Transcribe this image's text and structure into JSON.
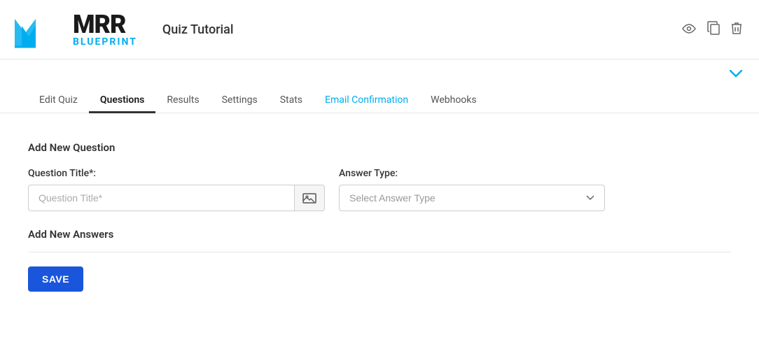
{
  "header": {
    "title": "Quiz Tutorial",
    "icons": {
      "eye": "👁",
      "copy": "⧉",
      "trash": "🗑"
    }
  },
  "nav": {
    "tabs": [
      {
        "id": "edit-quiz",
        "label": "Edit Quiz",
        "active": false,
        "special": false
      },
      {
        "id": "questions",
        "label": "Questions",
        "active": true,
        "special": false
      },
      {
        "id": "results",
        "label": "Results",
        "active": false,
        "special": false
      },
      {
        "id": "settings",
        "label": "Settings",
        "active": false,
        "special": false
      },
      {
        "id": "stats",
        "label": "Stats",
        "active": false,
        "special": false
      },
      {
        "id": "email-confirmation",
        "label": "Email Confirmation",
        "active": false,
        "special": true
      },
      {
        "id": "webhooks",
        "label": "Webhooks",
        "active": false,
        "special": false
      }
    ]
  },
  "form": {
    "section_title": "Add New Question",
    "question_label": "Question Title*:",
    "question_placeholder": "Question Title*",
    "answer_type_label": "Answer Type:",
    "answer_type_placeholder": "Select Answer Type",
    "answers_section_title": "Add New Answers",
    "save_button_label": "SAVE"
  },
  "chevron": "∨",
  "logo": {
    "mrr": "MRR",
    "blueprint": "BLUEPRINT"
  }
}
